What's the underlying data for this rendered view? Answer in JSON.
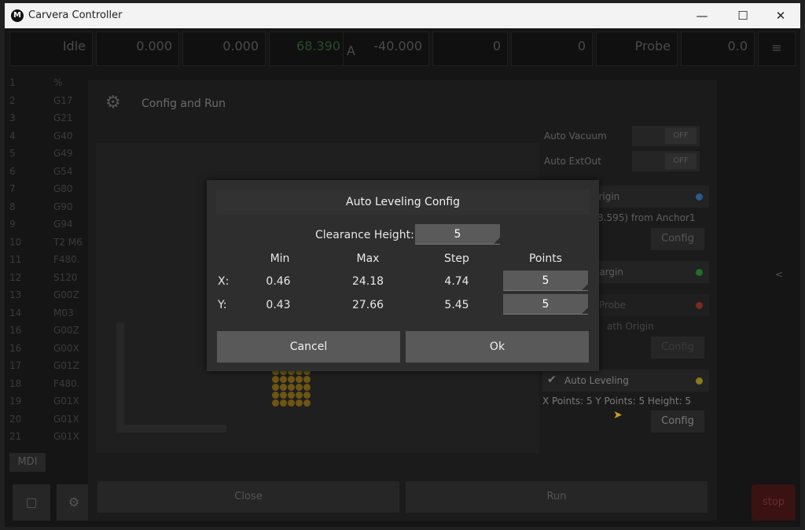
{
  "window": {
    "title": "Carvera Controller",
    "logo": "M",
    "minimize": "—",
    "maximize": "☐",
    "close": "✕"
  },
  "topbar": {
    "status": "Idle",
    "x": "0.000",
    "y": "0.000",
    "z": "68.390",
    "a_label": "A",
    "a": "-40.000",
    "feed": "0",
    "spindle": "0",
    "probe": "Probe",
    "tool": "0.0"
  },
  "gcode": {
    "lines": [
      {
        "n": "1",
        "c": "%"
      },
      {
        "n": "2",
        "c": "G17"
      },
      {
        "n": "3",
        "c": "G21"
      },
      {
        "n": "4",
        "c": "G40"
      },
      {
        "n": "5",
        "c": "G49"
      },
      {
        "n": "6",
        "c": "G54"
      },
      {
        "n": "7",
        "c": "G80"
      },
      {
        "n": "8",
        "c": "G90"
      },
      {
        "n": "9",
        "c": "G94"
      },
      {
        "n": "10",
        "c": "T2 M6"
      },
      {
        "n": "11",
        "c": "F480."
      },
      {
        "n": "12",
        "c": "S120"
      },
      {
        "n": "13",
        "c": "G00Z"
      },
      {
        "n": "14",
        "c": "M03"
      },
      {
        "n": "16",
        "c": "G00Z"
      },
      {
        "n": "16",
        "c": "G00X"
      },
      {
        "n": "17",
        "c": "G01Z"
      },
      {
        "n": "18",
        "c": "F480."
      },
      {
        "n": "19",
        "c": "G01X"
      },
      {
        "n": "20",
        "c": "G01X"
      },
      {
        "n": "21",
        "c": "G01X"
      }
    ],
    "mdi": "MDI"
  },
  "config_panel": {
    "title": "Config and Run",
    "auto_vacuum": "Auto Vacuum",
    "auto_extout": "Auto ExtOut",
    "off": "OFF",
    "origin_label": "Origin",
    "origin_text": "8.595) from Anchor1",
    "config": "Config",
    "margin_label": "Margin",
    "probe_label": "Probe",
    "path_origin": "ath Origin",
    "auto_leveling": "Auto Leveling",
    "leveling_summary": "X Points: 5 Y Points: 5 Height: 5",
    "close": "Close",
    "run": "Run",
    "stop": "stop",
    "colors": {
      "origin_dot": "#2a5a8a",
      "margin_dot": "#1f6e2a",
      "probe_dot": "#7a2a22",
      "leveling_dot": "#8a7a1c"
    }
  },
  "modal": {
    "title": "Auto Leveling Config",
    "clearance_label": "Clearance Height:",
    "clearance_value": "5",
    "headers": {
      "min": "Min",
      "max": "Max",
      "step": "Step",
      "points": "Points"
    },
    "rows": [
      {
        "axis": "X:",
        "min": "0.46",
        "max": "24.18",
        "step": "4.74",
        "points": "5"
      },
      {
        "axis": "Y:",
        "min": "0.43",
        "max": "27.66",
        "step": "5.45",
        "points": "5"
      }
    ],
    "cancel": "Cancel",
    "ok": "Ok"
  }
}
